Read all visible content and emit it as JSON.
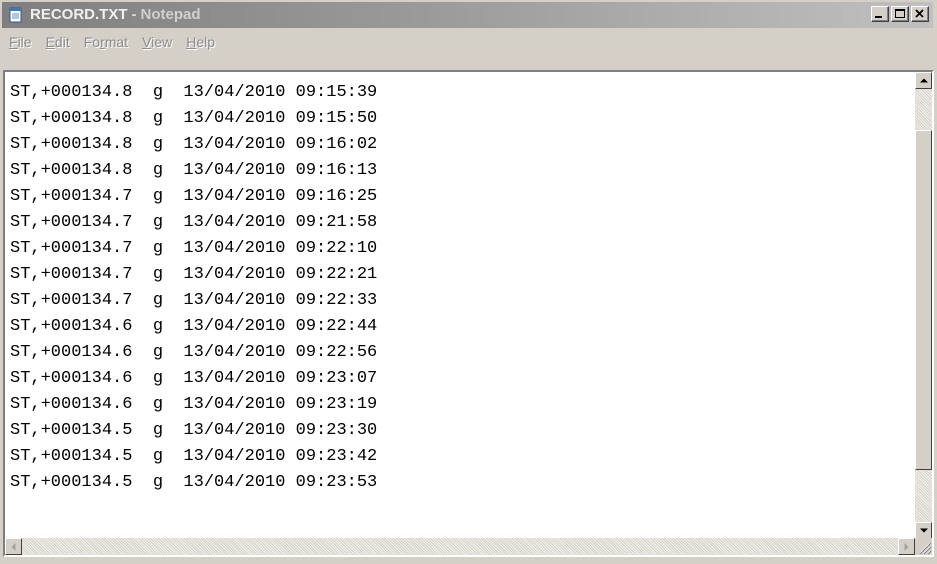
{
  "window": {
    "file_name": "RECORD.TXT",
    "separator": "-",
    "app_name": "Notepad"
  },
  "title_buttons": {
    "minimize_icon": "minimize-icon",
    "maximize_icon": "maximize-icon",
    "close_icon": "close-icon"
  },
  "menu": {
    "items": [
      {
        "first": "F",
        "rest": "ile"
      },
      {
        "first": "E",
        "rest": "dit"
      },
      {
        "first": "Fo",
        "under": "r",
        "rest": "mat"
      },
      {
        "first": "V",
        "rest": "iew"
      },
      {
        "first": "H",
        "rest": "elp"
      }
    ]
  },
  "document": {
    "lines": [
      "ST,+000134.8  g  13/04/2010 09:15:39",
      "ST,+000134.8  g  13/04/2010 09:15:50",
      "ST,+000134.8  g  13/04/2010 09:16:02",
      "ST,+000134.8  g  13/04/2010 09:16:13",
      "ST,+000134.7  g  13/04/2010 09:16:25",
      "ST,+000134.7  g  13/04/2010 09:21:58",
      "ST,+000134.7  g  13/04/2010 09:22:10",
      "ST,+000134.7  g  13/04/2010 09:22:21",
      "ST,+000134.7  g  13/04/2010 09:22:33",
      "ST,+000134.6  g  13/04/2010 09:22:44",
      "ST,+000134.6  g  13/04/2010 09:22:56",
      "ST,+000134.6  g  13/04/2010 09:23:07",
      "ST,+000134.6  g  13/04/2010 09:23:19",
      "ST,+000134.5  g  13/04/2010 09:23:30",
      "ST,+000134.5  g  13/04/2010 09:23:42",
      "ST,+000134.5  g  13/04/2010 09:23:53"
    ]
  },
  "colors": {
    "title_gradient_start": "#7f7f7f",
    "title_gradient_end": "#c0c0c0",
    "chrome": "#d4d0c8",
    "menu_text_disabled": "#8c8c8c"
  }
}
